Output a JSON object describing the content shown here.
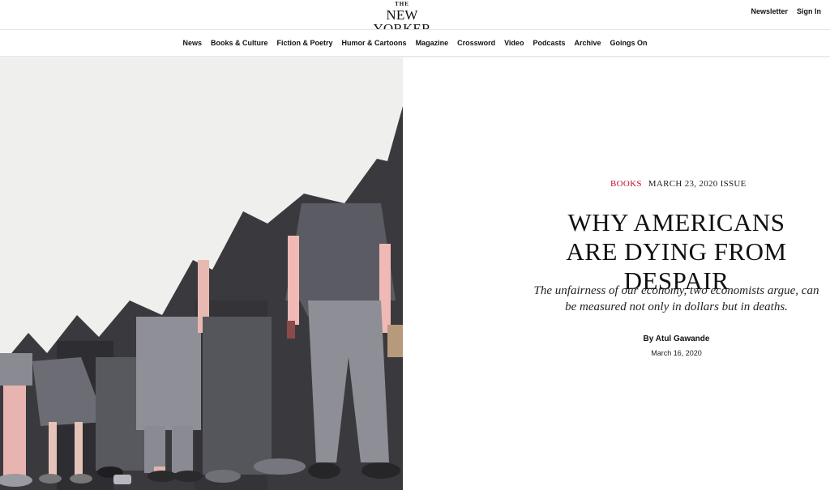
{
  "header": {
    "logo_small": "THE",
    "logo_name": "NEW YORKER",
    "newsletter_label": "Newsletter",
    "signin_label": "Sign In"
  },
  "nav": {
    "items": [
      "News",
      "Books & Culture",
      "Fiction & Poetry",
      "Humor & Cartoons",
      "Magazine",
      "Crossword",
      "Video",
      "Podcasts",
      "Archive",
      "Goings On"
    ]
  },
  "article": {
    "rubric": "BOOKS",
    "issue": "MARCH 23, 2020 ISSUE",
    "headline": "WHY AMERICANS ARE DYING FROM DESPAIR",
    "dek": "The unfairness of our economy, two economists argue, can be measured not only in dollars but in deaths.",
    "byline_prefix": "By",
    "author": "Atul Gawande",
    "date": "March 16, 2020"
  },
  "colors": {
    "rubric": "#c8102e",
    "text": "#111111",
    "hero_paper": "#f1f1ef",
    "hero_shadow": "#3a3a3e"
  }
}
